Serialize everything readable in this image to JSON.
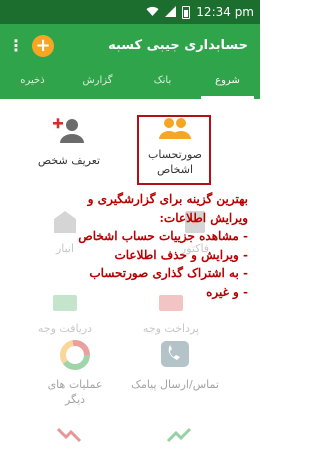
{
  "status_bar": {
    "time": "12:34 pm",
    "icons": [
      "wifi-icon",
      "signal-icon",
      "battery-icon"
    ]
  },
  "app_bar": {
    "title": "حسابداری جیبی کسبه",
    "icons": [
      "overflow-menu-icon",
      "add-icon"
    ]
  },
  "tabs": [
    {
      "label": "شروع",
      "active": true
    },
    {
      "label": "بانک",
      "active": false
    },
    {
      "label": "گزارش",
      "active": false
    },
    {
      "label": "ذخیره",
      "active": false
    }
  ],
  "grid": {
    "items": [
      {
        "label": "صورتحساب\nاشخاص",
        "icon": "people-icon",
        "highlighted": true
      },
      {
        "label": "تعریف شخص",
        "icon": "add-person-icon",
        "highlighted": false
      },
      {
        "label": "فاکتور",
        "icon": "invoice-icon"
      },
      {
        "label": "انبار",
        "icon": "warehouse-icon"
      },
      {
        "label": "دریافت وجه",
        "icon": "receive-money-icon"
      },
      {
        "label": "پرداخت وجه",
        "icon": "pay-money-icon"
      },
      {
        "label": "تماس/ارسال پیامک",
        "icon": "phone-sms-icon"
      },
      {
        "label": "عملیات های\nدیگر",
        "icon": "pie-chart-icon"
      }
    ]
  },
  "overlay": {
    "lines": [
      "بهترین گزینه برای گزارشگیری و",
      "ویرایش اطلاعات:",
      "- مشاهده جزییات حساب اشخاص",
      "- ویرایش و حذف اطلاعات",
      "- به اشتراک گذاری صورتحساب",
      "- و غیره"
    ]
  },
  "colors": {
    "primary": "#2fa44a",
    "status_bar": "#1b6e2e",
    "accent_orange": "#f6a623",
    "highlight_border": "#b11116",
    "overlay_text": "#b80000"
  }
}
